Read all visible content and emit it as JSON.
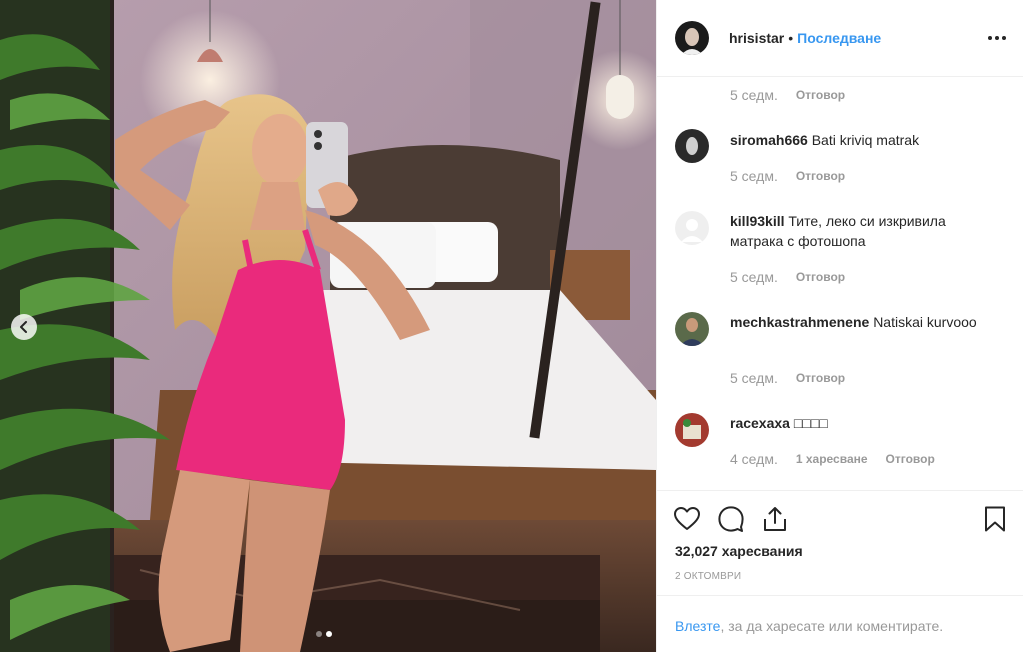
{
  "photo": {
    "alt": "",
    "prev_icon": "chevron-left-icon",
    "slides_total": 2,
    "active_slide": 2
  },
  "post_header": {
    "username": "hrisistar",
    "separator": "•",
    "follow_label": "Последване",
    "more_icon": "more-horizontal-icon"
  },
  "comments": [
    {
      "username": "",
      "text": "",
      "time": "5 седм.",
      "likes": "",
      "reply": "Отговор"
    },
    {
      "username": "siromah666",
      "text": "Bati kriviq matrak",
      "time": "5 седм.",
      "likes": "",
      "reply": "Отговор"
    },
    {
      "username": "kill93kill",
      "text": "Тите, леко си изкривила матрака с фотошопа",
      "time": "5 седм.",
      "likes": "",
      "reply": "Отговор"
    },
    {
      "username": "mechkastrahmenene",
      "text": "Natiskai kurvooo",
      "time": "5 седм.",
      "likes": "",
      "reply": "Отговор"
    },
    {
      "username": "racexaxa",
      "text": "□□□□",
      "time": "4 седм.",
      "likes": "1 харесване",
      "reply": "Отговор"
    }
  ],
  "actions": {
    "like_icon": "heart-icon",
    "comment_icon": "comment-icon",
    "share_icon": "share-icon",
    "save_icon": "bookmark-icon",
    "likes_count": "32,027",
    "likes_label": "харесвания",
    "date": "2 октомври"
  },
  "login_prompt": {
    "link": "Влезте",
    "text": ", за да харесате или коментирате."
  },
  "colors": {
    "link": "#3897f0",
    "muted": "#999999",
    "text": "#262626",
    "border": "#efefef"
  }
}
